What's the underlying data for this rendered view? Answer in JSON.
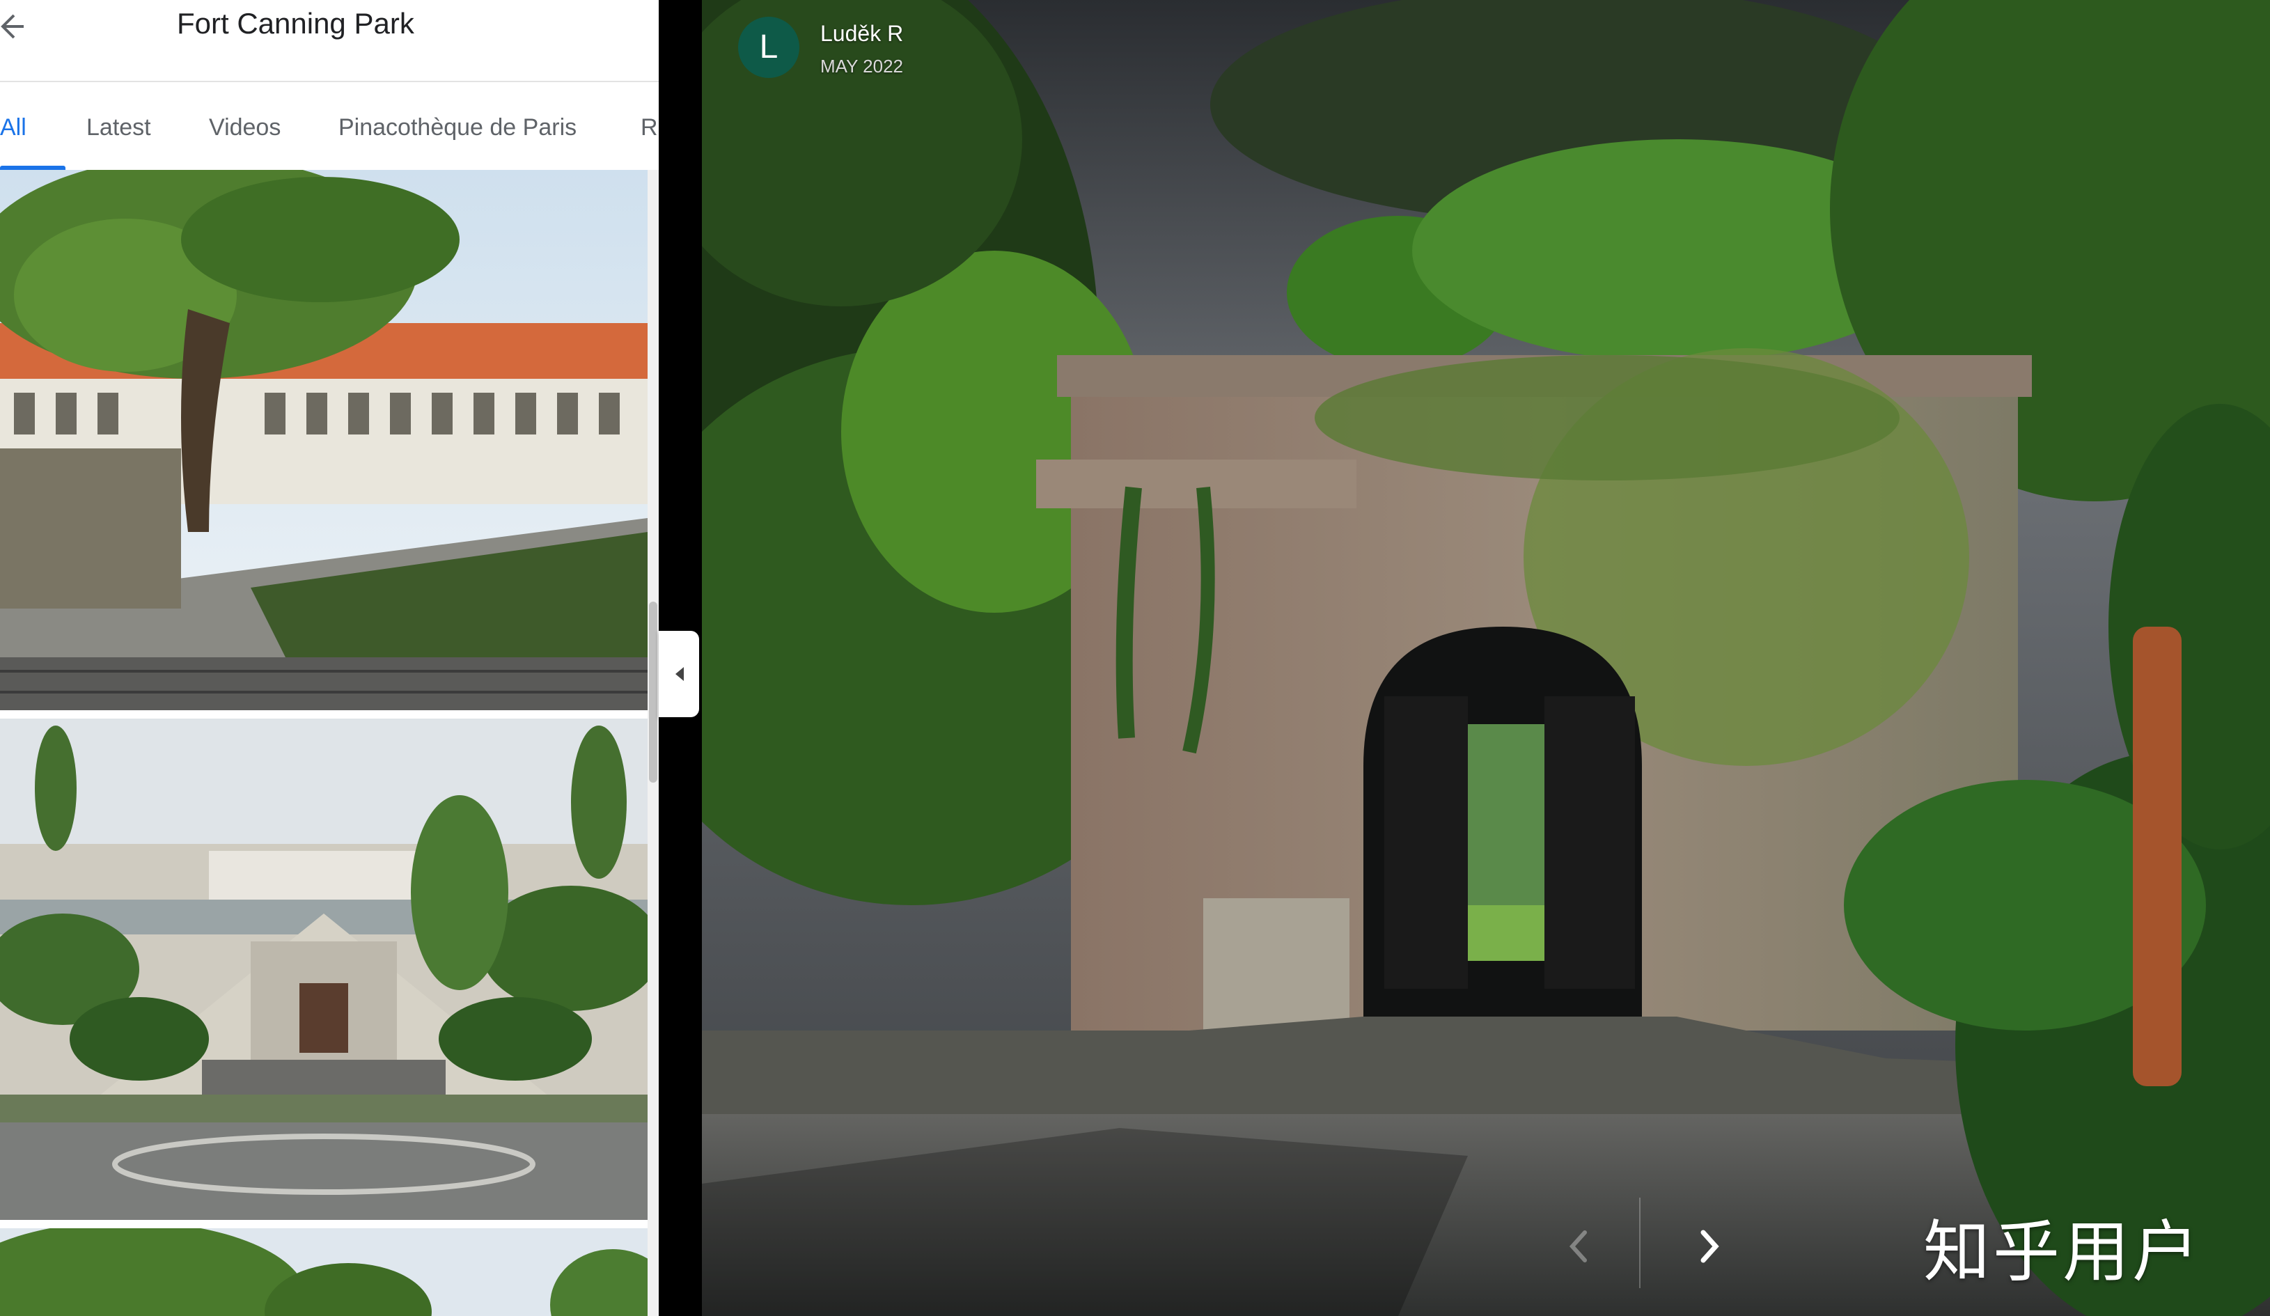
{
  "header": {
    "title": "Fort Canning Park",
    "back_icon": "arrow-left-icon"
  },
  "tabs": [
    {
      "label": "All",
      "active": true
    },
    {
      "label": "Latest",
      "active": false
    },
    {
      "label": "Videos",
      "active": false
    },
    {
      "label": "Pinacothèque de Paris",
      "active": false
    },
    {
      "label": "R",
      "active": false
    }
  ],
  "viewer": {
    "author_initial": "L",
    "author_name": "Luděk R",
    "date": "MAY 2022",
    "prev_icon": "chevron-left-icon",
    "next_icon": "chevron-right-icon",
    "watermark": "知乎用户"
  },
  "colors": {
    "accent": "#1a73e8",
    "avatar_bg": "#0e5a48"
  }
}
